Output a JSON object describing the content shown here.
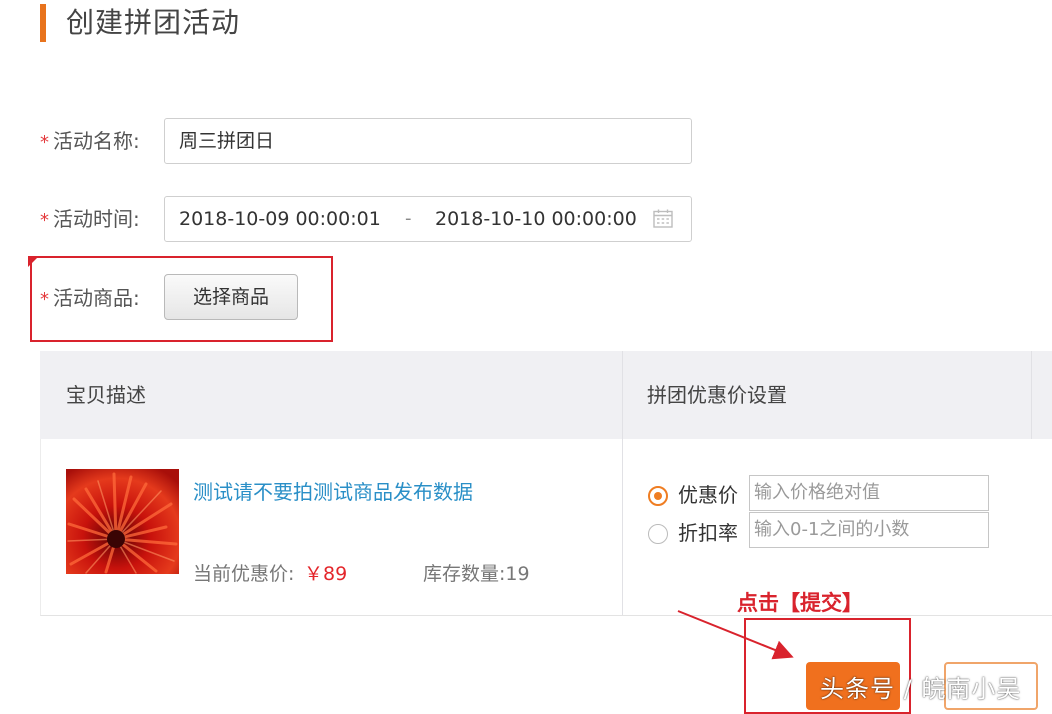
{
  "page": {
    "title": "创建拼团活动",
    "accent": "#e8731d"
  },
  "form": {
    "required_mark": "*",
    "name": {
      "label": "活动名称:",
      "value": "周三拼团日"
    },
    "time": {
      "label": "活动时间:",
      "start": "2018-10-09 00:00:01",
      "separator": "-",
      "end": "2018-10-10 00:00:00",
      "icon": "calendar-icon"
    },
    "goods": {
      "label": "活动商品:",
      "button": "选择商品"
    }
  },
  "table": {
    "headers": [
      "宝贝描述",
      "拼团优惠价设置"
    ],
    "rows": [
      {
        "product_title": "测试请不要拍测试商品发布数据",
        "price_label": "当前优惠价:",
        "price_value": "￥89",
        "stock_label": "库存数量:19",
        "options": [
          {
            "label": "优惠价",
            "selected": true,
            "placeholder": "输入价格绝对值"
          },
          {
            "label": "折扣率",
            "selected": false,
            "placeholder": "输入0-1之间的小数"
          }
        ]
      }
    ]
  },
  "annotation": {
    "text": "点击【提交】",
    "color": "#d9232d"
  },
  "watermark": "头条号 / 皖南小吴"
}
